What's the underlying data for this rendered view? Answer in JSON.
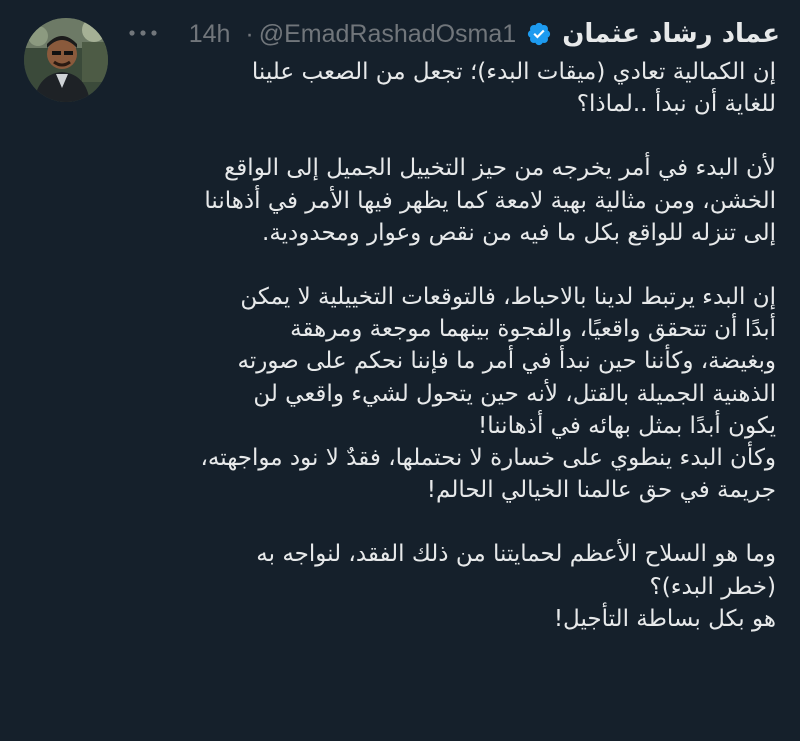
{
  "author": {
    "display_name": "عماد رشاد عثمان",
    "handle": "@EmadRashadOsma1",
    "separator": "·",
    "time": "14h",
    "verified": true
  },
  "colors": {
    "background": "#15202b",
    "text": "#e7e9ea",
    "muted": "#71767b",
    "verified_badge": "#1d9bf0"
  },
  "more_icon": "more-horizontal-icon",
  "tweet": {
    "paragraphs": [
      {
        "lines": [
          "إن الكمالية تعادي (ميقات البدء)؛ تجعل من الصعب علينا",
          "للغاية أن نبدأ ..لماذا؟"
        ]
      },
      {
        "lines": [
          "لأن البدء في أمر يخرجه من حيز التخييل الجميل إلى الواقع",
          "الخشن، ومن مثالية بهية لامعة كما يظهر فيها الأمر في أذهاننا",
          "إلى تنزله للواقع بكل ما فيه من نقص وعوار ومحدودية."
        ]
      },
      {
        "lines": [
          "إن البدء يرتبط لدينا بالاحباط، فالتوقعات التخييلية لا يمكن",
          "أبدًا أن تتحقق واقعيًا، والفجوة بينهما موجعة ومرهقة",
          "وبغيضة، وكأننا حين نبدأ في أمر ما فإننا نحكم على صورته",
          "الذهنية الجميلة بالقتل، لأنه حين يتحول لشيء واقعي لن",
          "يكون أبدًا بمثل بهائه في أذهاننا!",
          "وكأن البدء ينطوي على خسارة لا نحتملها، فقدٌ لا نود مواجهته،",
          "جريمة في حق عالمنا الخيالي الحالم!"
        ]
      },
      {
        "lines": [
          "وما هو السلاح الأعظم لحمايتنا من ذلك الفقد، لنواجه به",
          "(خطر البدء)؟",
          "هو بكل بساطة التأجيل!"
        ]
      }
    ]
  }
}
